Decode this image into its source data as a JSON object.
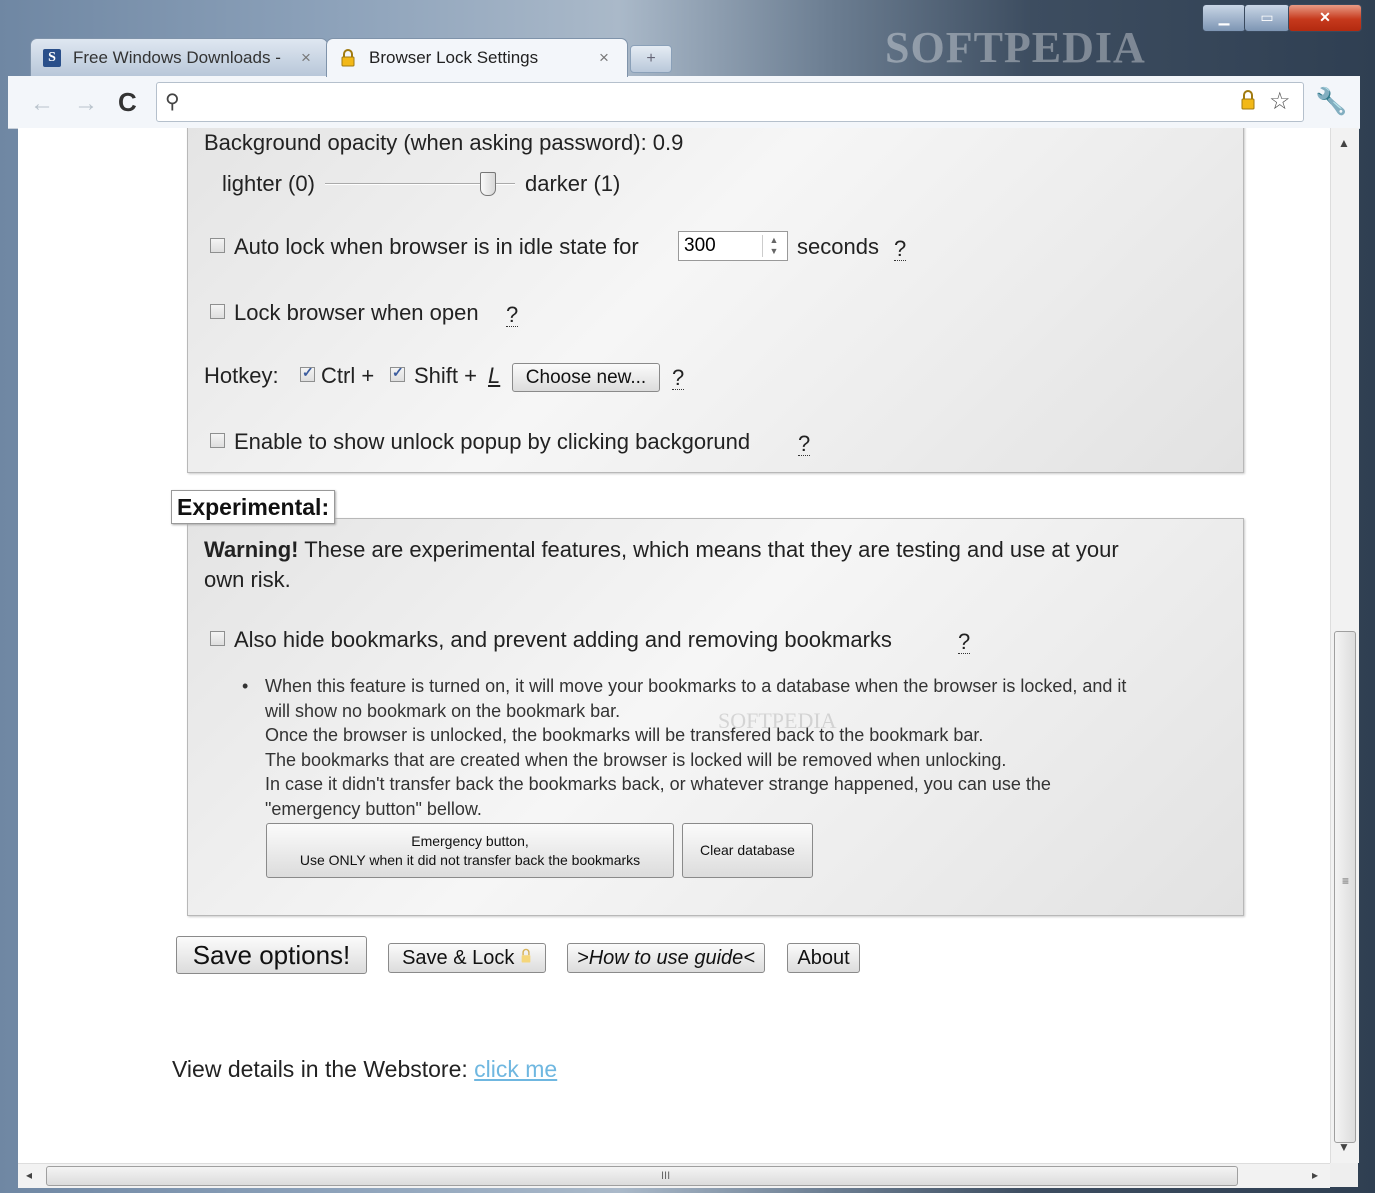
{
  "window": {
    "watermark": "SOFTPEDIA",
    "controls": {
      "minimize": "▁",
      "maximize": "▭",
      "close": "✕"
    }
  },
  "tabs": [
    {
      "favicon": "S",
      "title": "Free Windows Downloads -",
      "close": "×"
    },
    {
      "favicon": "lock-icon",
      "title": "Browser Lock Settings",
      "close": "×"
    }
  ],
  "toolbar": {
    "url": ""
  },
  "settings": {
    "opacity_label": "Background opacity (when asking password): 0.9",
    "opacity_value": 0.9,
    "slider_min_label": "lighter (0)",
    "slider_max_label": "darker (1)",
    "autolock_label": "Auto lock when browser is in idle state for",
    "autolock_seconds": "300",
    "autolock_unit": "seconds",
    "lock_on_open_label": "Lock browser when open",
    "hotkey_label": "Hotkey:",
    "hotkey_ctrl": "Ctrl +",
    "hotkey_shift": "Shift +",
    "hotkey_key": "L",
    "choose_new": "Choose new...",
    "unlock_popup_label": "Enable to show unlock popup by clicking backgorund",
    "help": "?"
  },
  "experimental": {
    "legend": "Experimental:",
    "warning_bold": "Warning!",
    "warning_text_1": "These are experimental features, which means that they are testing and use at your",
    "warning_text_2": "own risk.",
    "hide_bookmarks_label": "Also hide bookmarks, and prevent adding and removing bookmarks",
    "notes": [
      "When this feature is turned on, it will move your bookmarks to a database when the browser is locked, and it",
      "will show no bookmark on the bookmark bar.",
      "Once the browser is unlocked, the bookmarks will be transfered back to the bookmark bar.",
      "The bookmarks that are created when the browser is locked will be removed when unlocking.",
      "In case it didn't transfer back the bookmarks back, or whatever strange happened, you can use the",
      "\"emergency button\" bellow."
    ],
    "emergency_line1": "Emergency button,",
    "emergency_line2": "Use ONLY when it did not transfer back the bookmarks",
    "clear_database": "Clear database"
  },
  "actions": {
    "save": "Save options!",
    "save_lock": "Save & Lock",
    "guide": ">How to use guide<",
    "about": "About"
  },
  "footer": {
    "webstore_text": "View details in the Webstore:",
    "webstore_link": "click me"
  },
  "scrollbar": {
    "grip": "≡",
    "hgrip": "III"
  }
}
